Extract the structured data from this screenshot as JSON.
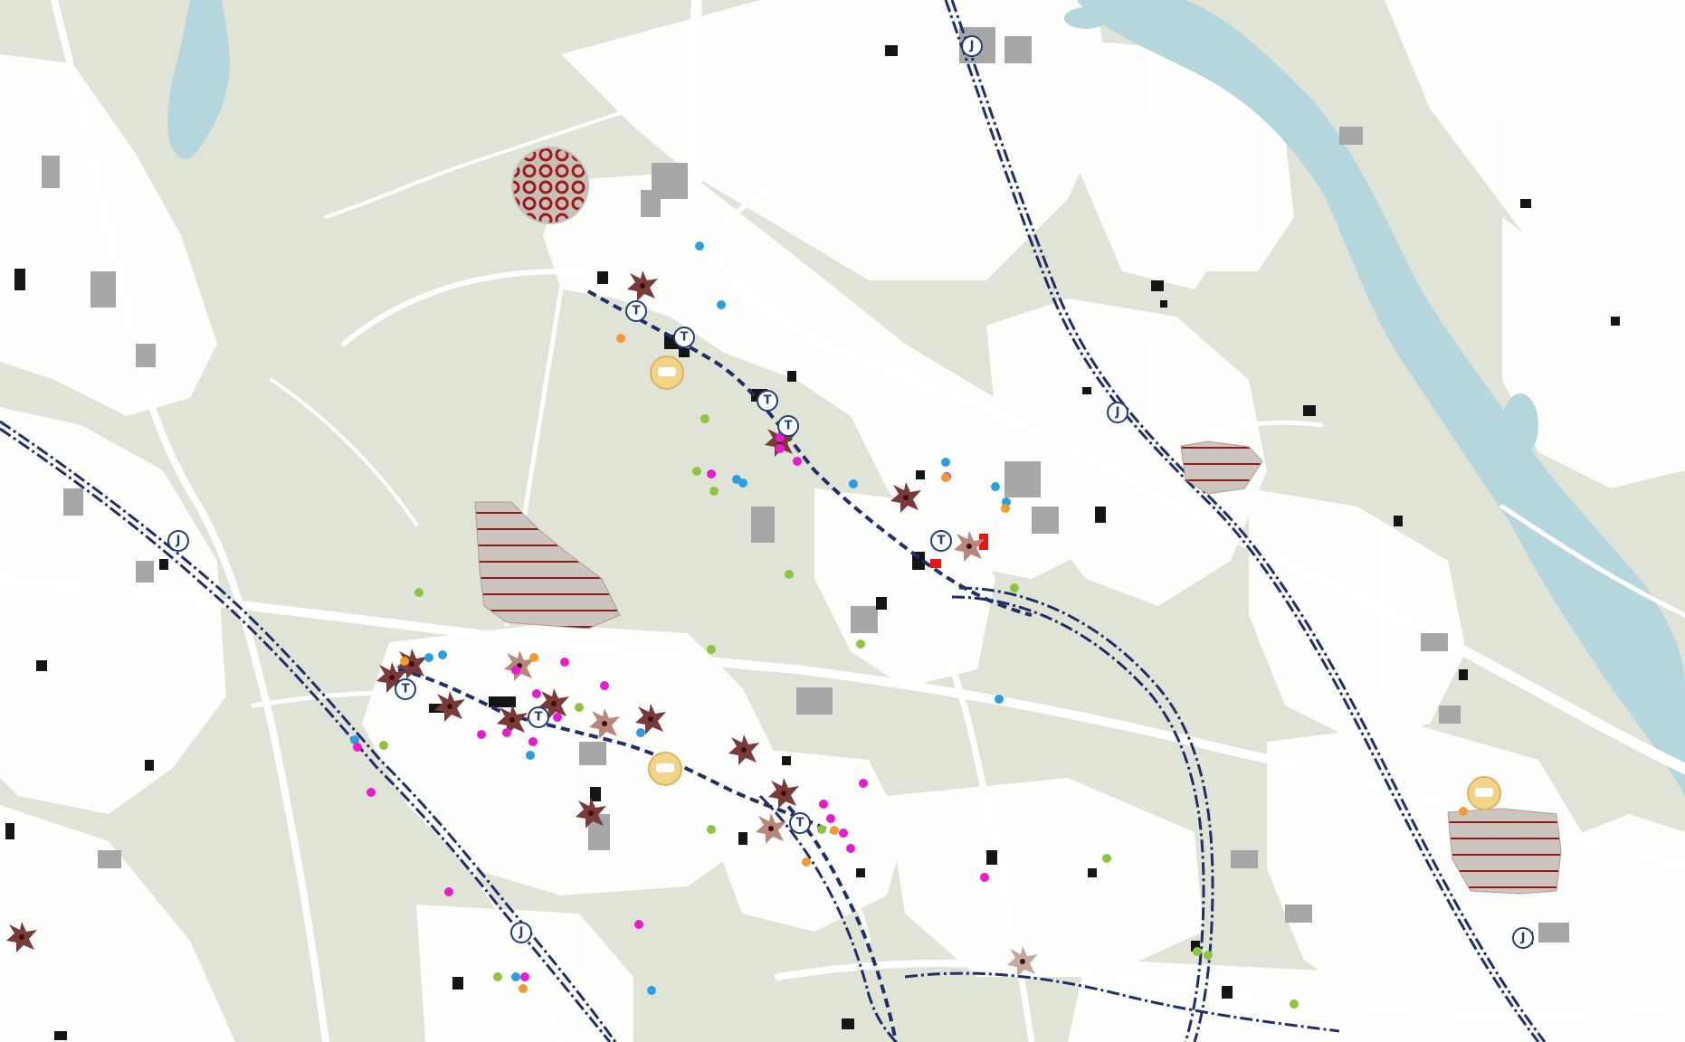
{
  "map": {
    "colors": {
      "land": "#dfe4d6",
      "urban": "#ffffff",
      "water": "#b6d6de",
      "building_grey": "#a7a7a7",
      "building_black": "#151515",
      "road": "#ffffff",
      "rail": "#1f2f68",
      "hatch_fill": "#cdc5bd",
      "hatch_line": "#8e1d1d",
      "station_stroke": "#1f3f78"
    },
    "station_symbols": {
      "metro": "T",
      "rail": "J"
    },
    "poi_colors": {
      "blue": "#2a9fe0",
      "green": "#8cc63e",
      "magenta": "#ea1ad1",
      "orange": "#f29a2e",
      "red": "#e9150f"
    },
    "icons": {
      "star_marker": "burst-star-icon",
      "gold_marker": "vehicle-circle-icon",
      "pattern_marker": "red-pattern-circle-icon"
    }
  }
}
